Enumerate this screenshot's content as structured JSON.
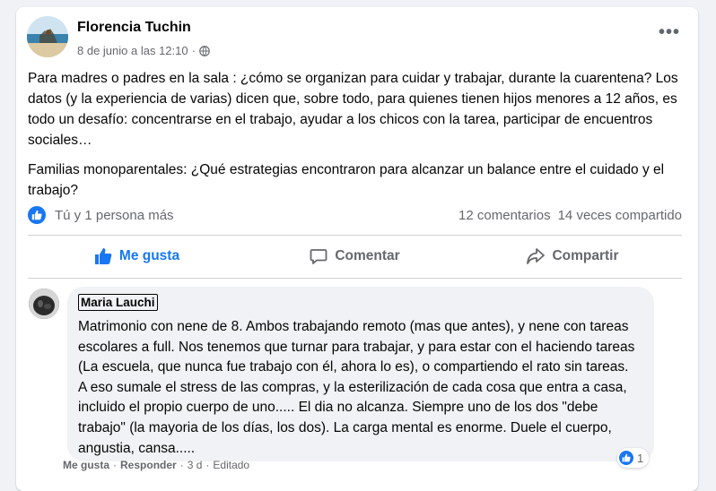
{
  "post": {
    "author": "Florencia Tuchin",
    "date": "8 de junio a las 12:10",
    "separator": "·",
    "more_label": "•••",
    "paragraphs": [
      "Para madres o padres en la sala : ¿cómo se organizan para cuidar y trabajar, durante la cuarentena? Los datos (y la experiencia de varias) dicen que, sobre todo, para quienes tienen hijos menores a 12 años, es todo un desafío: concentrarse en el trabajo, ayudar a los chicos con la tarea, participar de encuentros sociales…",
      "Familias monoparentales: ¿Qué estrategias encontraron para alcanzar un balance entre el cuidado y el trabajo?"
    ]
  },
  "reactions": {
    "summary": "Tú y 1 persona más",
    "comments": "12 comentarios",
    "shares": "14 veces compartido"
  },
  "actions": {
    "like": "Me gusta",
    "comment": "Comentar",
    "share": "Compartir"
  },
  "comment": {
    "author": "Maria Lauchi",
    "text": "Matrimonio con nene de 8. Ambos trabajando remoto (mas que antes), y nene con tareas escolares a full. Nos tenemos que turnar para trabajar, y para estar con el haciendo tareas (La escuela, que nunca fue trabajo con él, ahora lo es), o compartiendo el rato sin tareas. A eso sumale el stress de las compras, y la esterilización de cada cosa que entra a casa, incluido el propio cuerpo de uno..... El dia no alcanza. Siempre uno de los dos \"debe trabajo\" (la mayoria de los días, los dos). La carga mental es enorme. Duele el cuerpo, angustia, cansa.....",
    "reaction_count": "1",
    "footer": {
      "like": "Me gusta",
      "reply": "Responder",
      "time": "3 d",
      "edited": "Editado",
      "dot": "·"
    }
  },
  "colors": {
    "accent": "#1877f2",
    "secondary_text": "#65676b",
    "background": "#f0f2f5"
  }
}
